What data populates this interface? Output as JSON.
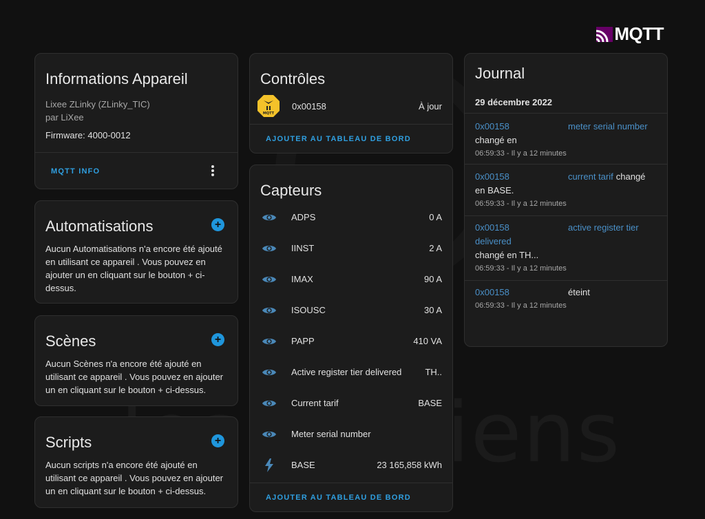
{
  "logo": {
    "text": "MQTT"
  },
  "watermark": {
    "text": "les alexiens"
  },
  "device_info": {
    "title": "Informations Appareil",
    "model": "Lixee ZLinky (ZLinky_TIC)",
    "manufacturer": "par LiXee",
    "firmware": "Firmware: 4000-0012",
    "mqtt_info_label": "MQTT INFO"
  },
  "automations": {
    "title": "Automatisations",
    "text": "Aucun Automatisations n'a encore été ajouté en utilisant ce appareil . Vous pouvez en ajouter un en cliquant sur le bouton + ci-dessus."
  },
  "scenes": {
    "title": "Scènes",
    "text": "Aucun Scènes n'a encore été ajouté en utilisant ce appareil . Vous pouvez en ajouter un en cliquant sur le bouton + ci-dessus."
  },
  "scripts": {
    "title": "Scripts",
    "text": "Aucun scripts n'a encore été ajouté en utilisant ce appareil . Vous pouvez en ajouter un en cliquant sur le bouton + ci-dessus."
  },
  "controls": {
    "title": "Contrôles",
    "item_name": "0x00158",
    "item_state": "À jour",
    "add_label": "AJOUTER AU TABLEAU DE BORD"
  },
  "sensors": {
    "title": "Capteurs",
    "items": [
      {
        "label": "ADPS",
        "value": "0 A",
        "icon": "eye-icon"
      },
      {
        "label": "IINST",
        "value": "2 A",
        "icon": "eye-icon"
      },
      {
        "label": "IMAX",
        "value": "90 A",
        "icon": "eye-icon"
      },
      {
        "label": "ISOUSC",
        "value": "30 A",
        "icon": "eye-icon"
      },
      {
        "label": "PAPP",
        "value": "410 VA",
        "icon": "eye-icon"
      },
      {
        "label": "Active register tier delivered",
        "value": "TH..",
        "icon": "eye-icon"
      },
      {
        "label": "Current tarif",
        "value": "BASE",
        "icon": "eye-icon"
      },
      {
        "label": "Meter serial number",
        "value": "",
        "icon": "eye-icon"
      },
      {
        "label": "BASE",
        "value": "23 165,858 kWh",
        "icon": "lightning-icon"
      }
    ],
    "add_label": "AJOUTER AU TABLEAU DE BORD"
  },
  "journal": {
    "title": "Journal",
    "date": "29 décembre 2022",
    "entries": [
      {
        "device": "0x00158",
        "entity": "meter serial number",
        "action": "changé en",
        "time": "06:59:33 - Il y a 12 minutes"
      },
      {
        "device": "0x00158",
        "entity": "current tarif",
        "action": "changé",
        "action2": "en BASE.",
        "time": "06:59:33 - Il y a 12 minutes"
      },
      {
        "device": "0x00158",
        "entity": "active register tier",
        "entity2": "delivered",
        "action": "changé en TH...",
        "time": "06:59:33 - Il y a 12 minutes"
      },
      {
        "device": "0x00158",
        "entity": "",
        "action": "éteint",
        "time": "06:59:33 - Il y a 12 minutes"
      }
    ]
  },
  "colors": {
    "accent": "#2f9fe0",
    "link": "#4a90c8",
    "icon": "#4a88b8",
    "card": "#1c1c1c",
    "background": "#111111"
  }
}
